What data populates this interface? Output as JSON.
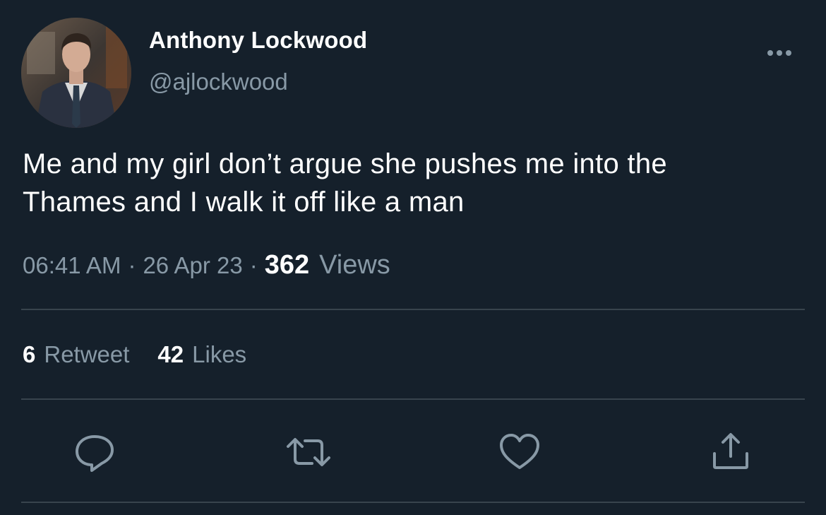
{
  "author": {
    "display_name": "Anthony Lockwood",
    "handle": "@ajlockwood",
    "avatar_icon": "profile-photo"
  },
  "tweet": {
    "text_line1": "Me and my girl don’t argue she pushes me into the",
    "text_line2": "Thames and I walk it off like a man"
  },
  "meta": {
    "time": "06:41 AM",
    "separator": "·",
    "date": "26 Apr 23",
    "views_count": "362",
    "views_label": "Views"
  },
  "stats": {
    "retweets_count": "6",
    "retweets_label": "Retweet",
    "likes_count": "42",
    "likes_label": "Likes"
  },
  "actions": {
    "reply_icon": "reply-icon",
    "retweet_icon": "retweet-icon",
    "like_icon": "heart-icon",
    "share_icon": "share-icon",
    "more_icon": "more-horizontal-icon"
  },
  "colors": {
    "background": "#15202b",
    "secondary_text": "#8899a6",
    "divider": "#38444d",
    "icon": "#8899a6"
  }
}
